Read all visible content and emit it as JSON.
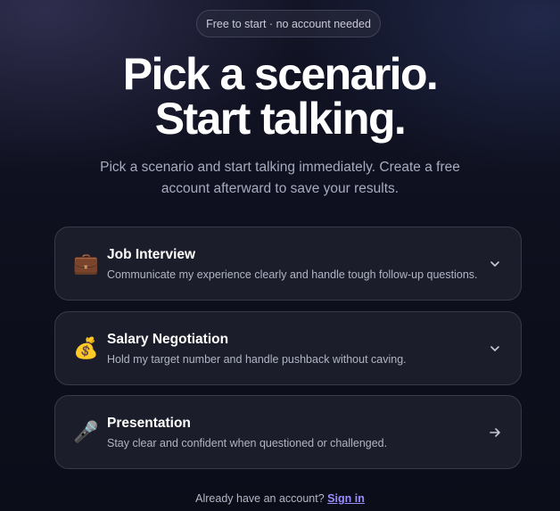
{
  "badge": {
    "label": "Free to start · no account needed"
  },
  "hero": {
    "line1": "Pick a scenario.",
    "line2": "Start talking."
  },
  "subtitle": "Pick a scenario and start talking immediately. Create a free account afterward to save your results.",
  "scenarios": [
    {
      "icon": "briefcase-icon",
      "emoji": "💼",
      "title": "Job Interview",
      "description": "Communicate my experience clearly and handle tough follow-up questions.",
      "action": "chevron-down-icon"
    },
    {
      "icon": "money-bag-icon",
      "emoji": "💰",
      "title": "Salary Negotiation",
      "description": "Hold my target number and handle pushback without caving.",
      "action": "chevron-down-icon"
    },
    {
      "icon": "microphone-icon",
      "emoji": "🎤",
      "title": "Presentation",
      "description": "Stay clear and confident when questioned or challenged.",
      "action": "arrow-right-icon"
    }
  ],
  "footer": {
    "prompt": "Already have an account?",
    "link_label": "Sign in"
  },
  "colors": {
    "accent_link": "#9d8cff",
    "card_bg": "#1b1e2a",
    "card_border": "#363a4b",
    "page_bg": "#0d0f1d"
  }
}
